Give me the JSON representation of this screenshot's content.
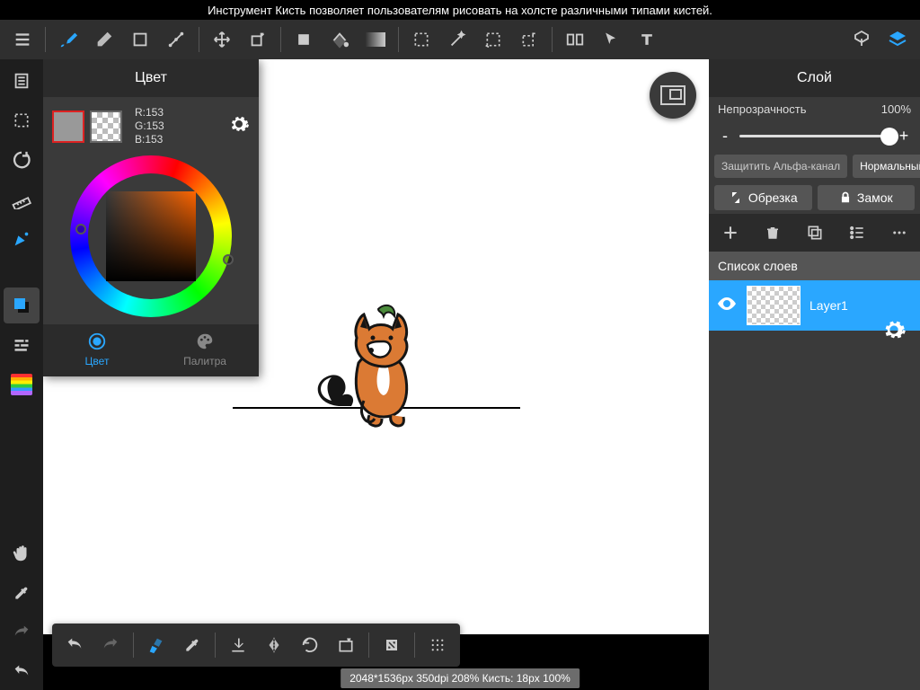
{
  "tooltip": "Инструмент Кисть позволяет пользователям рисовать на холсте различными типами кистей.",
  "color_panel": {
    "title": "Цвет",
    "rgb": {
      "r": "R:153",
      "g": "G:153",
      "b": "B:153"
    },
    "tab_color": "Цвет",
    "tab_palette": "Палитра"
  },
  "layer_panel": {
    "title": "Слой",
    "opacity_label": "Непрозрачность",
    "opacity_value": "100%",
    "minus": "-",
    "plus": "+",
    "protect_alpha": "Защитить Альфа-канал",
    "blend_mode": "Нормальный",
    "crop": "Обрезка",
    "lock": "Замок",
    "list_header": "Список слоев",
    "layers": [
      {
        "name": "Layer1"
      }
    ]
  },
  "status": "2048*1536px 350dpi 208% Кисть: 18px 100%"
}
